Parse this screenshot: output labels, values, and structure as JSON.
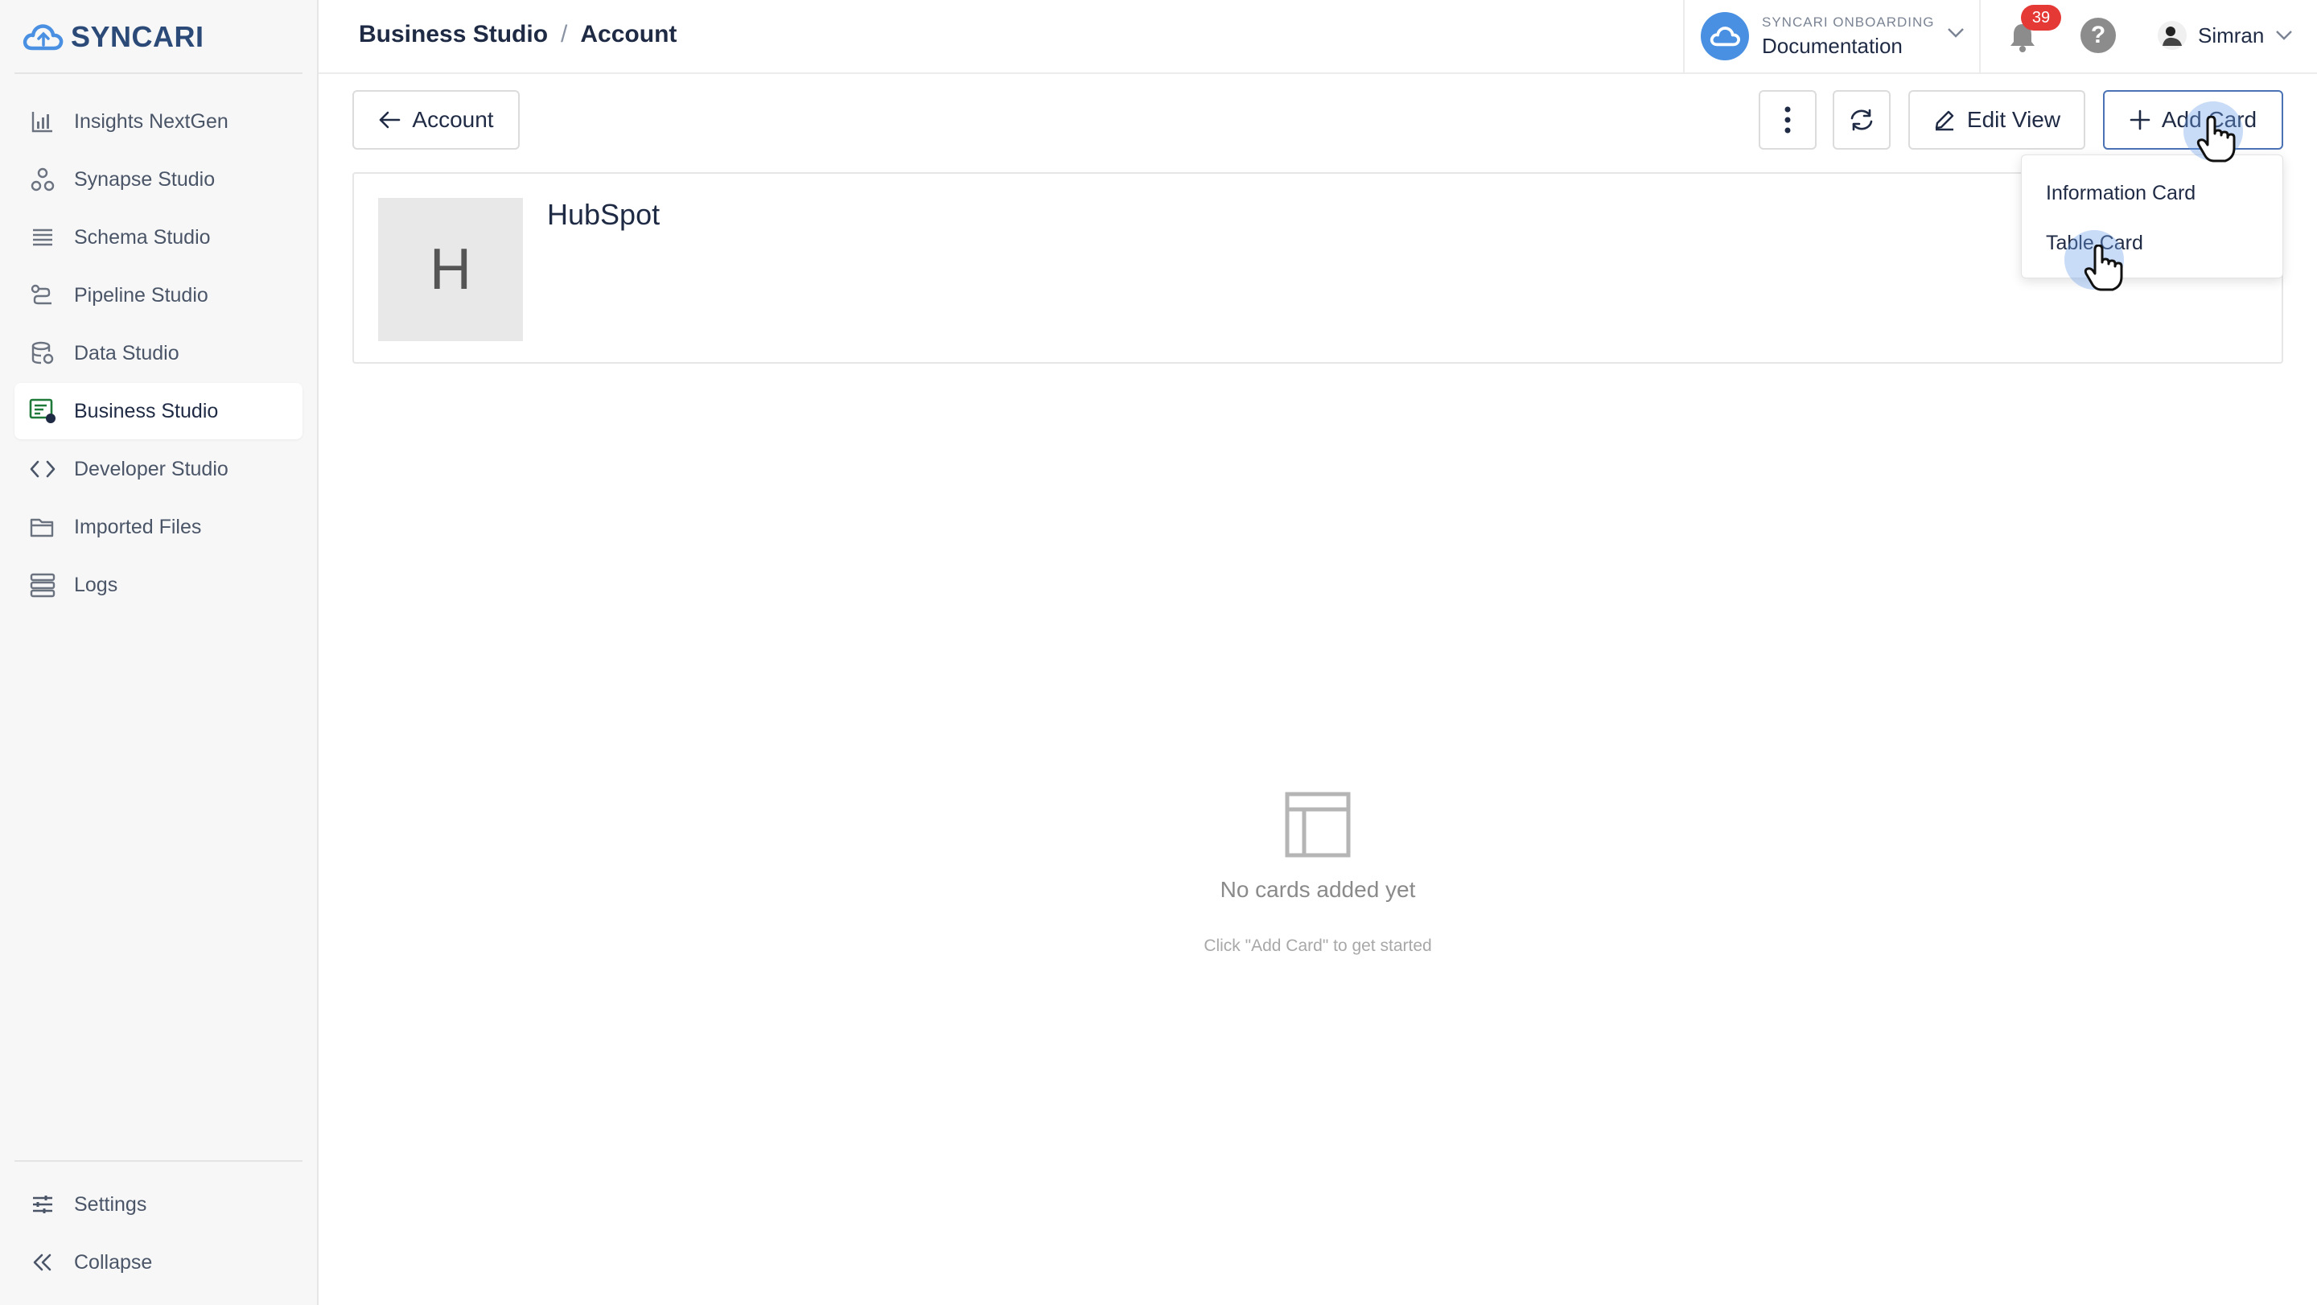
{
  "brand": {
    "name": "SYNCARI",
    "color": "#2b4a78",
    "accent": "#4a90e2"
  },
  "sidebar": {
    "items": [
      {
        "label": "Insights NextGen",
        "icon": "bar-chart-icon",
        "active": false
      },
      {
        "label": "Synapse Studio",
        "icon": "synapse-icon",
        "active": false
      },
      {
        "label": "Schema Studio",
        "icon": "schema-list-icon",
        "active": false
      },
      {
        "label": "Pipeline Studio",
        "icon": "pipeline-icon",
        "active": false
      },
      {
        "label": "Data Studio",
        "icon": "database-icon",
        "active": false
      },
      {
        "label": "Business Studio",
        "icon": "business-icon",
        "active": true
      },
      {
        "label": "Developer Studio",
        "icon": "code-icon",
        "active": false
      },
      {
        "label": "Imported Files",
        "icon": "folder-icon",
        "active": false
      },
      {
        "label": "Logs",
        "icon": "logs-icon",
        "active": false
      }
    ],
    "bottom": [
      {
        "label": "Settings",
        "icon": "sliders-icon"
      },
      {
        "label": "Collapse",
        "icon": "double-chevron-left-icon"
      }
    ]
  },
  "header": {
    "breadcrumb": [
      "Business Studio",
      "Account"
    ],
    "breadcrumb_separator": "/",
    "org_label": "SYNCARI ONBOARDING",
    "org_name": "Documentation",
    "notification_count": "39",
    "help_symbol": "?",
    "user_name": "Simran"
  },
  "toolbar": {
    "back_label": "Account",
    "edit_label": "Edit View",
    "add_label": "Add Card"
  },
  "record": {
    "initial": "H",
    "name": "HubSpot"
  },
  "add_menu": {
    "items": [
      "Information Card",
      "Table Card"
    ]
  },
  "empty_state": {
    "title": "No cards added yet",
    "subtitle": "Click \"Add Card\" to get started"
  }
}
